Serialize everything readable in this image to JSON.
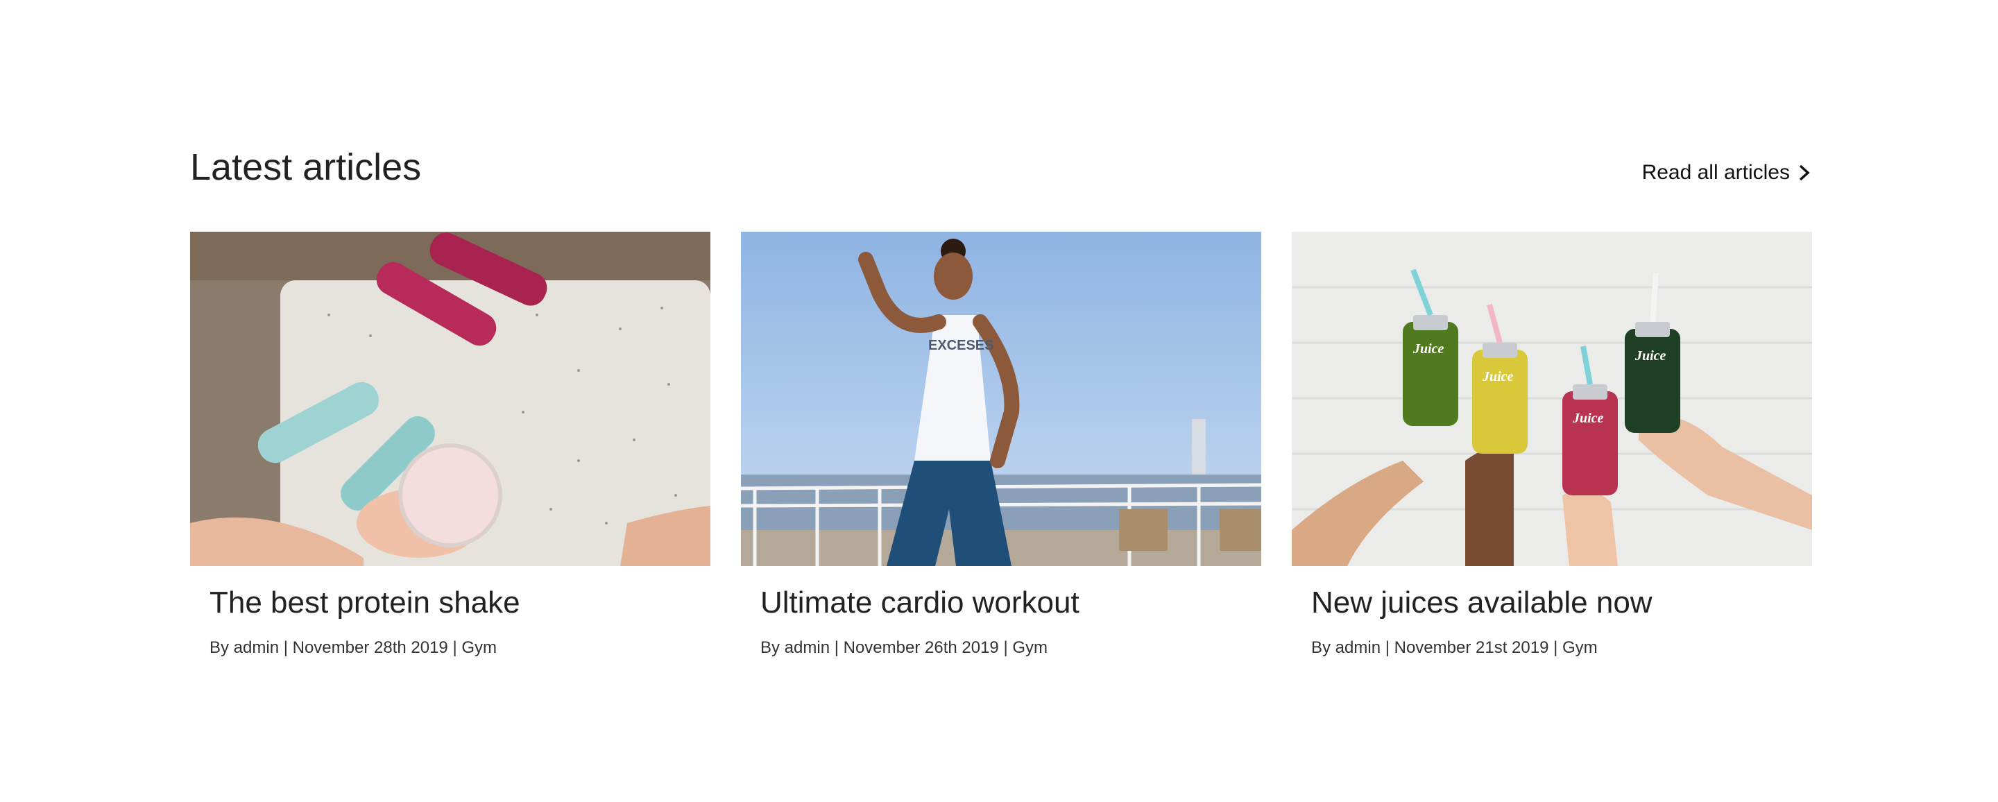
{
  "section": {
    "heading": "Latest articles",
    "read_all_label": "Read all articles"
  },
  "icons": {
    "read_all": "chevron-right-icon"
  },
  "articles": [
    {
      "title": "The best protein shake",
      "by": "By admin",
      "date": "November 28th 2019",
      "category": "Gym",
      "image": "dumbbells-and-protein-shake"
    },
    {
      "title": "Ultimate cardio workout",
      "by": "By admin",
      "date": "November 26th 2019",
      "category": "Gym",
      "image": "woman-flexing-by-waterfront"
    },
    {
      "title": "New juices available now",
      "by": "By admin",
      "date": "November 21st 2019",
      "category": "Gym",
      "image": "hands-holding-juice-bottles"
    }
  ],
  "separator": " | ",
  "colors": {
    "background": "#ffffff",
    "text": "#222222",
    "meta_text": "#333333"
  }
}
